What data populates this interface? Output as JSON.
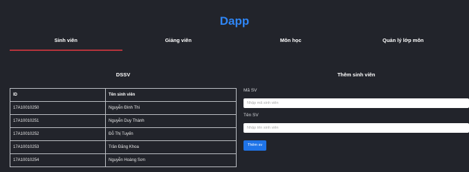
{
  "app": {
    "title": "Dapp"
  },
  "tabs": [
    {
      "label": "Sinh viên",
      "active": true
    },
    {
      "label": "Giảng viên",
      "active": false
    },
    {
      "label": "Môn học",
      "active": false
    },
    {
      "label": "Quản lý lớp môn",
      "active": false
    }
  ],
  "list_section": {
    "title": "DSSV",
    "columns": [
      "ID",
      "Tên sinh viên"
    ],
    "rows": [
      [
        "17A10010250",
        "Nguyễn Đình Thi"
      ],
      [
        "17A10010251",
        "Nguyễn Duy Thành"
      ],
      [
        "17A10010252",
        "Đỗ Thị Tuyến"
      ],
      [
        "17A10010253",
        "Trần Đăng Khoa"
      ],
      [
        "17A10010254",
        "Nguyễn Hoàng Sơn"
      ]
    ]
  },
  "form_section": {
    "title": "Thêm sinh viên",
    "id_label": "Mã SV",
    "id_placeholder": "Nhập mã sinh viên",
    "id_value": "",
    "name_label": "Tên SV",
    "name_placeholder": "Nhập tên sinh viên",
    "name_value": "",
    "submit_label": "Thêm sv"
  },
  "colors": {
    "background": "#22242b",
    "title": "#2f86f6",
    "active_tab_underline": "#b8343c",
    "button": "#1f74e8"
  }
}
